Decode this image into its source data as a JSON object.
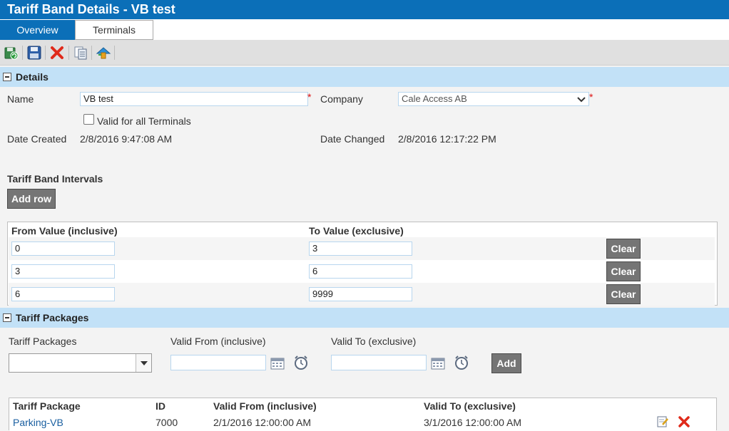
{
  "window": {
    "title": "Tariff Band Details - VB test"
  },
  "tabs": [
    {
      "label": "Overview"
    },
    {
      "label": "Terminals"
    }
  ],
  "toolbar": {
    "icons": [
      "refresh-icon",
      "save-icon",
      "delete-icon",
      "copy-icon",
      "upload-icon"
    ]
  },
  "details": {
    "section_title": "Details",
    "name_label": "Name",
    "name_value": "VB test",
    "required_mark": "*",
    "company_label": "Company",
    "company_value": "Cale Access AB",
    "valid_all_label": "Valid for all Terminals",
    "date_created_label": "Date Created",
    "date_created_value": "2/8/2016 9:47:08 AM",
    "date_changed_label": "Date Changed",
    "date_changed_value": "2/8/2016 12:17:22 PM"
  },
  "intervals": {
    "title": "Tariff Band Intervals",
    "add_row_label": "Add row",
    "col_from": "From Value (inclusive)",
    "col_to": "To Value (exclusive)",
    "clear_label": "Clear",
    "rows": [
      {
        "from": "0",
        "to": "3"
      },
      {
        "from": "3",
        "to": "6"
      },
      {
        "from": "6",
        "to": "9999"
      }
    ]
  },
  "packages": {
    "section_title": "Tariff Packages",
    "packages_label": "Tariff Packages",
    "valid_from_label": "Valid From (inclusive)",
    "valid_to_label": "Valid To (exclusive)",
    "add_label": "Add",
    "table_headers": [
      "Tariff Package",
      "ID",
      "Valid From (inclusive)",
      "Valid To (exclusive)"
    ],
    "rows": [
      {
        "package": "Parking-VB",
        "id": "7000",
        "valid_from": "2/1/2016 12:00:00 AM",
        "valid_to": "3/1/2016 12:00:00 AM"
      }
    ]
  }
}
